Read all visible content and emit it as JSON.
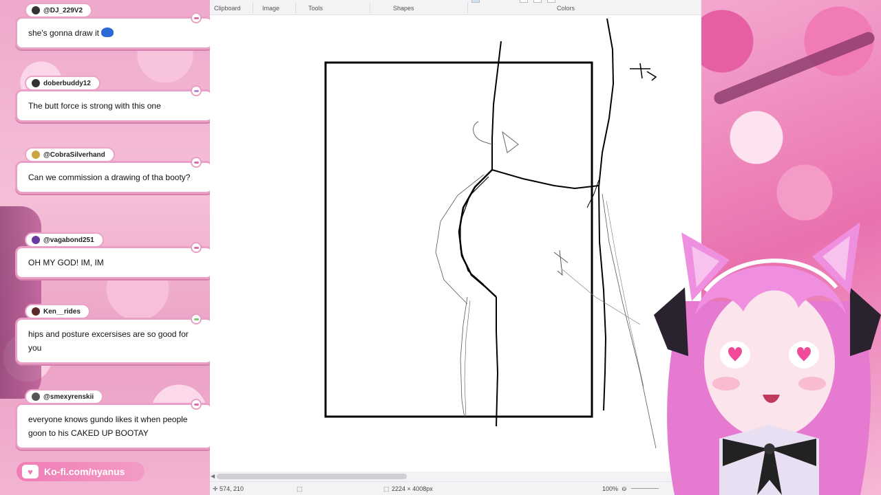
{
  "chat": {
    "messages": [
      {
        "user": "@DJ_229V2",
        "text": "she's gonna draw it",
        "accent": "#eaa0c6"
      },
      {
        "user": "doberbuddy12",
        "text": "The butt force is strong with this one",
        "accent": "#b08ad6"
      },
      {
        "user": "@CobraSilverhand",
        "text": "Can we commission a drawing of tha booty?",
        "accent": "#eaa0c6"
      },
      {
        "user": "@vagabond251",
        "text": "OH MY GOD! IM, IM",
        "accent": "#eaa0c6"
      },
      {
        "user": "Ken__rides",
        "text": "hips and posture excersises are so good for you",
        "accent": "#7acb6a"
      },
      {
        "user": "@smexyrenskii",
        "text": "everyone knows gundo likes it when people goon to his CAKED UP BOOTAY",
        "accent": "#eaa0c6"
      }
    ],
    "kofi_label": "Ko-fi.com/nyanus"
  },
  "paint": {
    "ribbon": {
      "clipboard": "Clipboard",
      "image": "Image",
      "tools": "Tools",
      "shapes": "Shapes",
      "colors": "Colors"
    },
    "status": {
      "cursor_pos": "574, 210",
      "canvas_size": "2224 × 4008px",
      "zoom": "100%"
    }
  },
  "colors": {
    "bubble_border": "#eaa0c6",
    "kofi": "#f07cb4"
  }
}
